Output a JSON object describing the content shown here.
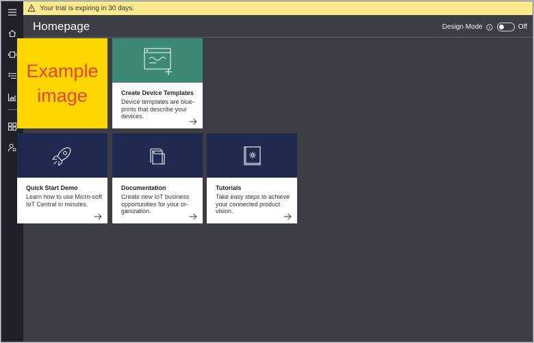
{
  "banner": {
    "text": "Your trial is expiring in 30 days."
  },
  "header": {
    "title": "Homepage",
    "design_mode_label": "Design Mode",
    "design_mode_state": "Off"
  },
  "rail": {
    "icons": [
      "menu-icon",
      "home-icon",
      "device-icon",
      "rules-icon",
      "analytics-icon",
      "dashboard-icon",
      "admin-icon"
    ]
  },
  "placeholder": {
    "line1": "Example",
    "line2": "image"
  },
  "tiles": [
    {
      "title": "Create Device Templates",
      "description": "Device templates are blue-prints that describe your devices.",
      "icon": "device-template-icon",
      "color": "#3c8874"
    },
    {
      "title": "Quick Start Demo",
      "description": "Learn how to use Micro-soft IoT Central in minutes.",
      "icon": "rocket-icon",
      "color": "#1f2a4e"
    },
    {
      "title": "Documentation",
      "description": "Create new IoT business opportunities for your or-ganization.",
      "icon": "document-icon",
      "color": "#1f2a4e"
    },
    {
      "title": "Tutorials",
      "description": "Take easy steps to achieve your connected product vision.",
      "icon": "book-icon",
      "color": "#1f2a4e"
    }
  ],
  "colors": {
    "banner": "#fbe98e",
    "rail": "#1e2228",
    "background": "#3b3e45"
  }
}
